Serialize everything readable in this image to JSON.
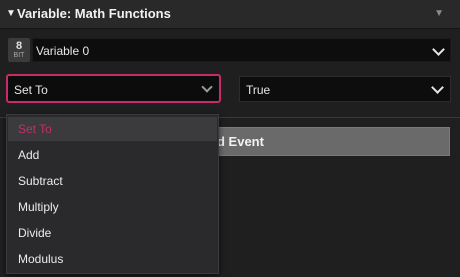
{
  "header": {
    "title": "Variable: Math Functions"
  },
  "variable": {
    "bit_number": "8",
    "bit_label": "BIT",
    "selected": "Variable 0"
  },
  "operation": {
    "selected": "Set To"
  },
  "value": {
    "selected": "True"
  },
  "event": {
    "label_visible": "d Event"
  },
  "dropdown": {
    "items": [
      "Set To",
      "Add",
      "Subtract",
      "Multiply",
      "Divide",
      "Modulus"
    ],
    "selected_index": 0
  },
  "colors": {
    "accent": "#c72c68",
    "background": "#1f1f20",
    "header": "#29292a",
    "field": "#0d0d0e",
    "menu": "#2a2a2c"
  }
}
